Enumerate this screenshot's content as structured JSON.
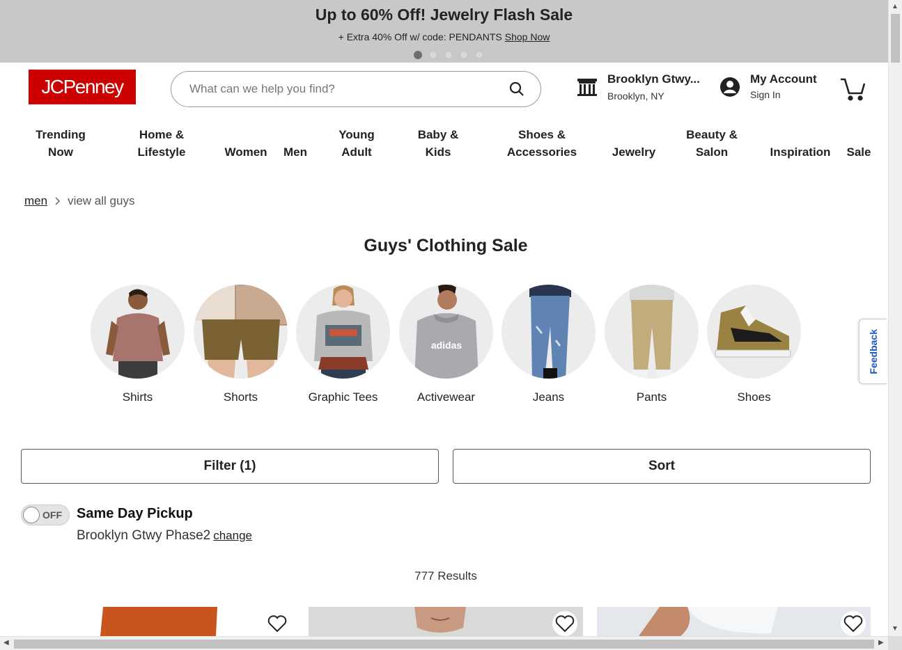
{
  "promo": {
    "title": "Up to 60% Off! Jewelry Flash Sale",
    "subtitle": "+ Extra 40% Off w/ code: PENDANTS",
    "link": "Shop Now",
    "active_slide": 1,
    "slide_count": 5
  },
  "header": {
    "logo": "JCPenney",
    "search_placeholder": "What can we help you find?",
    "store_name": "Brooklyn Gtwy...",
    "store_location": "Brooklyn, NY",
    "account_title": "My Account",
    "account_sub": "Sign In"
  },
  "nav": [
    {
      "line1": "Trending",
      "line2": "Now"
    },
    {
      "line1": "Home &",
      "line2": "Lifestyle"
    },
    {
      "line1": "",
      "line2": "Women"
    },
    {
      "line1": "",
      "line2": "Men"
    },
    {
      "line1": "Young",
      "line2": "Adult"
    },
    {
      "line1": "Baby &",
      "line2": "Kids"
    },
    {
      "line1": "Shoes &",
      "line2": "Accessories"
    },
    {
      "line1": "",
      "line2": "Jewelry"
    },
    {
      "line1": "Beauty &",
      "line2": "Salon"
    },
    {
      "line1": "",
      "line2": "Inspiration"
    },
    {
      "line1": "",
      "line2": "Sale"
    }
  ],
  "breadcrumb": {
    "parent": "men",
    "current": "view all guys"
  },
  "page_title": "Guys' Clothing Sale",
  "categories": [
    "Shirts",
    "Shorts",
    "Graphic Tees",
    "Activewear",
    "Jeans",
    "Pants",
    "Shoes"
  ],
  "filter_label": "Filter (1)",
  "sort_label": "Sort",
  "pickup": {
    "toggle_state": "OFF",
    "title": "Same Day Pickup",
    "store": "Brooklyn Gtwy Phase2",
    "change_link": "change"
  },
  "results": "777 Results",
  "feedback": "Feedback",
  "colors": {
    "brand_red": "#cc0000",
    "promo_bg": "#c8c8c8",
    "feedback_blue": "#1a56c4"
  }
}
